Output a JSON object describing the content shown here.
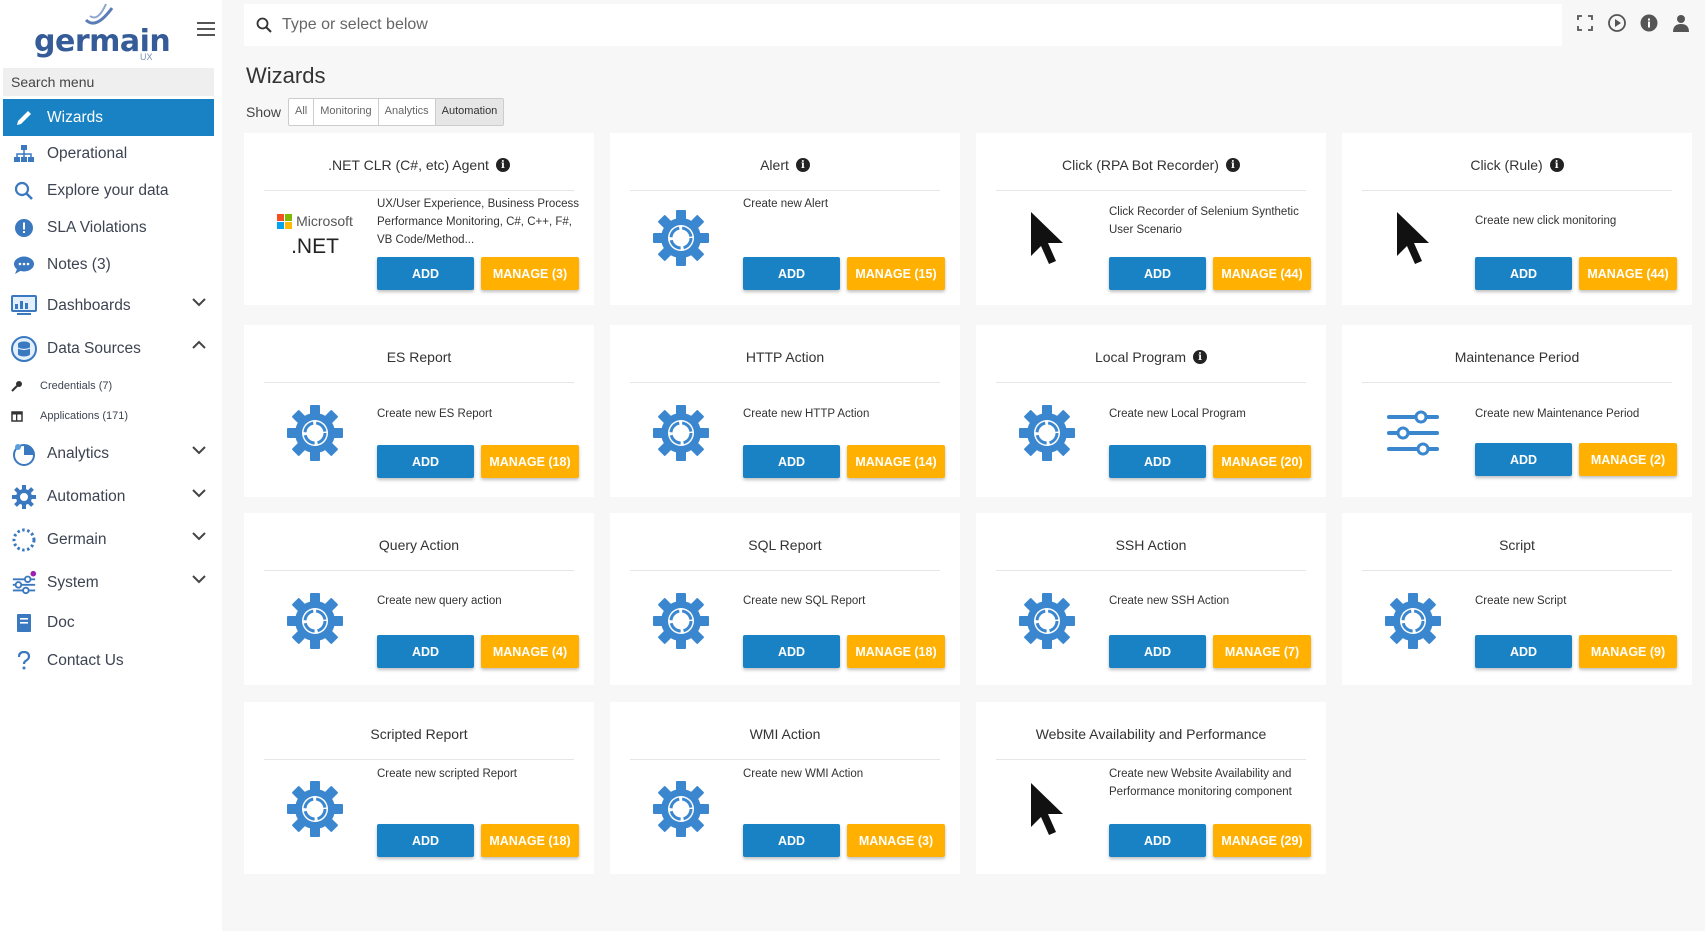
{
  "app": {
    "brand": "germain",
    "brand_sub": "UX",
    "accent": "#1982c4",
    "manage_color": "#ffb000"
  },
  "sidebar": {
    "search_placeholder": "Search menu",
    "items": [
      {
        "label": "Wizards",
        "icon": "pencil-icon"
      },
      {
        "label": "Operational",
        "icon": "hierarchy-icon"
      },
      {
        "label": "Explore your data",
        "icon": "search-icon"
      },
      {
        "label": "SLA Violations",
        "icon": "alert-circle-icon"
      },
      {
        "label": "Notes (3)",
        "icon": "chat-icon"
      },
      {
        "label": "Dashboards",
        "icon": "monitor-icon"
      },
      {
        "label": "Data Sources",
        "icon": "database-icon"
      },
      {
        "label": "Analytics",
        "icon": "analytics-icon"
      },
      {
        "label": "Automation",
        "icon": "gear-icon"
      },
      {
        "label": "Germain",
        "icon": "dotted-circle-icon"
      },
      {
        "label": "System",
        "icon": "sliders-icon"
      },
      {
        "label": "Doc",
        "icon": "book-icon"
      },
      {
        "label": "Contact Us",
        "icon": "question-icon"
      }
    ],
    "sub_items": [
      {
        "label": "Credentials (7)",
        "icon": "key-icon"
      },
      {
        "label": "Applications (171)",
        "icon": "window-icon"
      }
    ]
  },
  "topbar": {
    "search_placeholder": "Type or select below"
  },
  "page": {
    "title": "Wizards",
    "show_label": "Show",
    "filters": [
      "All",
      "Monitoring",
      "Analytics",
      "Automation"
    ],
    "active_filter": "Automation"
  },
  "cards": [
    {
      "title": ".NET CLR (C#, etc) Agent",
      "info": true,
      "icon": "dotnet-logo",
      "icon_text_1": "Microsoft",
      "icon_text_2": ".NET",
      "desc": "UX/User Experience, Business Process Performance Monitoring, C#, C++, F#, VB Code/Method...",
      "add": "ADD",
      "manage": "MANAGE (3)"
    },
    {
      "title": "Alert",
      "info": true,
      "icon": "gear-icon",
      "desc": "Create new Alert",
      "add": "ADD",
      "manage": "MANAGE (15)"
    },
    {
      "title": "Click (RPA Bot Recorder)",
      "info": true,
      "icon": "cursor-icon",
      "desc": "Click Recorder of Selenium Synthetic User Scenario",
      "add": "ADD",
      "manage": "MANAGE (44)"
    },
    {
      "title": "Click (Rule)",
      "info": true,
      "icon": "cursor-icon",
      "desc": "Create new click monitoring",
      "add": "ADD",
      "manage": "MANAGE (44)"
    },
    {
      "title": "ES Report",
      "info": false,
      "icon": "gear-icon",
      "desc": "Create new ES Report",
      "add": "ADD",
      "manage": "MANAGE (18)"
    },
    {
      "title": "HTTP Action",
      "info": false,
      "icon": "gear-icon",
      "desc": "Create new HTTP Action",
      "add": "ADD",
      "manage": "MANAGE (14)"
    },
    {
      "title": "Local Program",
      "info": true,
      "icon": "gear-icon",
      "desc": "Create new Local Program",
      "add": "ADD",
      "manage": "MANAGE (20)"
    },
    {
      "title": "Maintenance Period",
      "info": false,
      "icon": "sliders-icon",
      "desc": "Create new Maintenance Period",
      "add": "ADD",
      "manage": "MANAGE (2)"
    },
    {
      "title": "Query Action",
      "info": false,
      "icon": "gear-icon",
      "desc": "Create new query action",
      "add": "ADD",
      "manage": "MANAGE (4)"
    },
    {
      "title": "SQL Report",
      "info": false,
      "icon": "gear-icon",
      "desc": "Create new SQL Report",
      "add": "ADD",
      "manage": "MANAGE (18)"
    },
    {
      "title": "SSH Action",
      "info": false,
      "icon": "gear-icon",
      "desc": "Create new SSH Action",
      "add": "ADD",
      "manage": "MANAGE (7)"
    },
    {
      "title": "Script",
      "info": false,
      "icon": "gear-icon",
      "desc": "Create new Script",
      "add": "ADD",
      "manage": "MANAGE (9)"
    },
    {
      "title": "Scripted Report",
      "info": false,
      "icon": "gear-icon",
      "desc": "Create new scripted Report",
      "add": "ADD",
      "manage": "MANAGE (18)"
    },
    {
      "title": "WMI Action",
      "info": false,
      "icon": "gear-icon",
      "desc": "Create new WMI Action",
      "add": "ADD",
      "manage": "MANAGE (3)"
    },
    {
      "title": "Website Availability and Performance",
      "info": false,
      "icon": "cursor-icon",
      "desc": "Create new Website Availability and Performance monitoring component",
      "add": "ADD",
      "manage": "MANAGE (29)"
    }
  ]
}
